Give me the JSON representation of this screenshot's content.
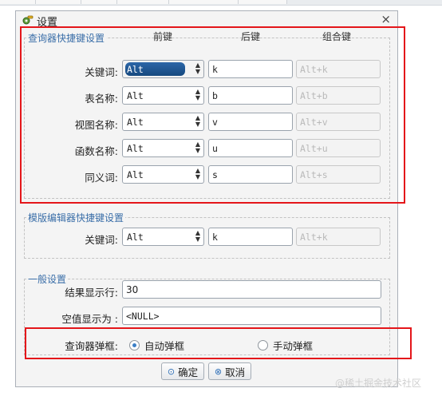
{
  "dialog": {
    "title": "设置",
    "title_icon": "gear-key-icon",
    "close_glyph": "×"
  },
  "query_group": {
    "legend": "查询器快捷键设置",
    "headers": [
      "前键",
      "后键",
      "组合键"
    ],
    "rows": [
      {
        "label": "关键词:",
        "front": "Alt",
        "back": "k",
        "combo": "Alt+k",
        "active": true
      },
      {
        "label": "表名称:",
        "front": "Alt",
        "back": "b",
        "combo": "Alt+b"
      },
      {
        "label": "视图名称:",
        "front": "Alt",
        "back": "v",
        "combo": "Alt+v"
      },
      {
        "label": "函数名称:",
        "front": "Alt",
        "back": "u",
        "combo": "Alt+u"
      },
      {
        "label": "同义词:",
        "front": "Alt",
        "back": "s",
        "combo": "Alt+s"
      }
    ]
  },
  "template_group": {
    "legend": "模版编辑器快捷键设置",
    "row": {
      "label": "关键词:",
      "front": "Alt",
      "back": "k",
      "combo": "Alt+k"
    }
  },
  "general_group": {
    "legend": "一般设置",
    "result_rows_label": "结果显示行:",
    "result_rows_value": "30",
    "null_label": "空值显示为 :",
    "null_value": "<NULL>",
    "popup_label": "查询器弹框:",
    "popup_options": [
      "自动弹框",
      "手动弹框"
    ],
    "popup_selected": "自动弹框"
  },
  "buttons": {
    "ok": "确定",
    "cancel": "取消"
  },
  "watermark": "@稀土掘金技术社区",
  "colors": {
    "highlight_box": "#e4161a",
    "legend_text": "#3a6ea8",
    "selected_option": "#1f5a96"
  }
}
